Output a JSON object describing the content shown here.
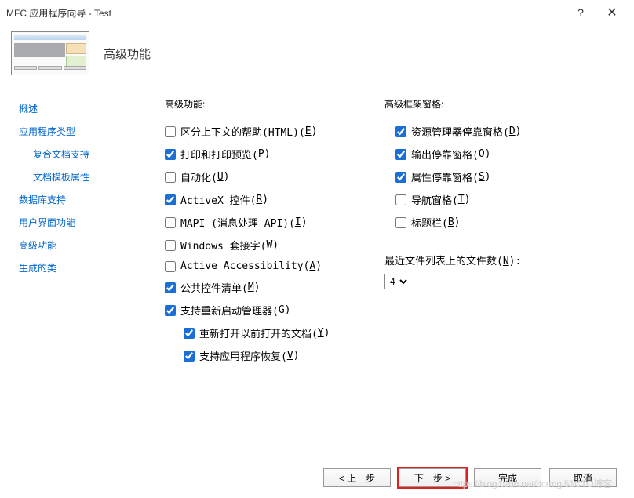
{
  "window": {
    "title": "MFC 应用程序向导 - Test"
  },
  "header": {
    "title": "高级功能"
  },
  "sidebar": {
    "items": [
      {
        "label": "概述",
        "sub": false
      },
      {
        "label": "应用程序类型",
        "sub": false
      },
      {
        "label": "复合文档支持",
        "sub": true
      },
      {
        "label": "文档模板属性",
        "sub": true
      },
      {
        "label": "数据库支持",
        "sub": false
      },
      {
        "label": "用户界面功能",
        "sub": false
      },
      {
        "label": "高级功能",
        "sub": false
      },
      {
        "label": "生成的类",
        "sub": false
      }
    ]
  },
  "left": {
    "heading": "高级功能:",
    "items": [
      {
        "label": "区分上下文的帮助(HTML)(",
        "accel": "E",
        "tail": ")",
        "checked": false,
        "sub": false
      },
      {
        "label": "打印和打印预览(",
        "accel": "P",
        "tail": ")",
        "checked": true,
        "sub": false
      },
      {
        "label": "自动化(",
        "accel": "U",
        "tail": ")",
        "checked": false,
        "sub": false
      },
      {
        "label": "ActiveX 控件(",
        "accel": "R",
        "tail": ")",
        "checked": true,
        "sub": false
      },
      {
        "label": "MAPI (消息处理 API)(",
        "accel": "I",
        "tail": ")",
        "checked": false,
        "sub": false
      },
      {
        "label": "Windows 套接字(",
        "accel": "W",
        "tail": ")",
        "checked": false,
        "sub": false
      },
      {
        "label": "Active Accessibility(",
        "accel": "A",
        "tail": ")",
        "checked": false,
        "sub": false
      },
      {
        "label": "公共控件清单(",
        "accel": "M",
        "tail": ")",
        "checked": true,
        "sub": false
      },
      {
        "label": "支持重新启动管理器(",
        "accel": "G",
        "tail": ")",
        "checked": true,
        "sub": false
      },
      {
        "label": "重新打开以前打开的文档(",
        "accel": "Y",
        "tail": ")",
        "checked": true,
        "sub": true
      },
      {
        "label": "支持应用程序恢复(",
        "accel": "V",
        "tail": ")",
        "checked": true,
        "sub": true
      }
    ]
  },
  "right": {
    "heading": "高级框架窗格:",
    "items": [
      {
        "label": "资源管理器停靠窗格(",
        "accel": "D",
        "tail": ")",
        "checked": true
      },
      {
        "label": "输出停靠窗格(",
        "accel": "O",
        "tail": ")",
        "checked": true
      },
      {
        "label": "属性停靠窗格(",
        "accel": "S",
        "tail": ")",
        "checked": true
      },
      {
        "label": "导航窗格(",
        "accel": "T",
        "tail": ")",
        "checked": false
      },
      {
        "label": "标题栏(",
        "accel": "B",
        "tail": ")",
        "checked": false
      }
    ],
    "mru_label": "最近文件列表上的文件数(",
    "mru_accel": "N",
    "mru_tail": "):",
    "mru_value": "4"
  },
  "footer": {
    "back": "< 上一步",
    "next": "下一步 >",
    "finish": "完成",
    "cancel": "取消"
  },
  "watermark": "https://blog.csdn.net/dcrmg  51CTO博客"
}
